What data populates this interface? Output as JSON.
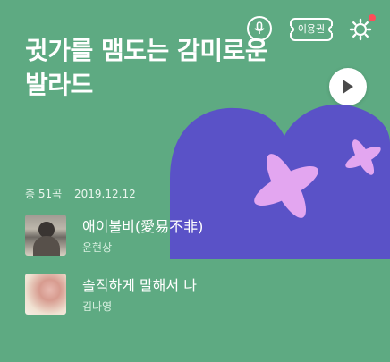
{
  "header": {
    "ticket_label": "이용권",
    "icons": [
      "mic-icon",
      "ticket-icon",
      "settings-icon",
      "notification-dot"
    ]
  },
  "playlist": {
    "title_line1": "귓가를 맴도는 감미로운",
    "title_line2": "발라드",
    "count": "총 51곡",
    "date": "2019.12.12",
    "play_icon": "play-icon"
  },
  "tracks": [
    {
      "title": "애이불비(愛易不非)",
      "artist": "윤현상"
    },
    {
      "title": "솔직하게 말해서 나",
      "artist": "김나영"
    }
  ],
  "colors": {
    "background": "#5eaa82",
    "graphic_blue": "#5a52c7",
    "graphic_pink": "#e3a6f0",
    "notification": "#ff4c58"
  }
}
